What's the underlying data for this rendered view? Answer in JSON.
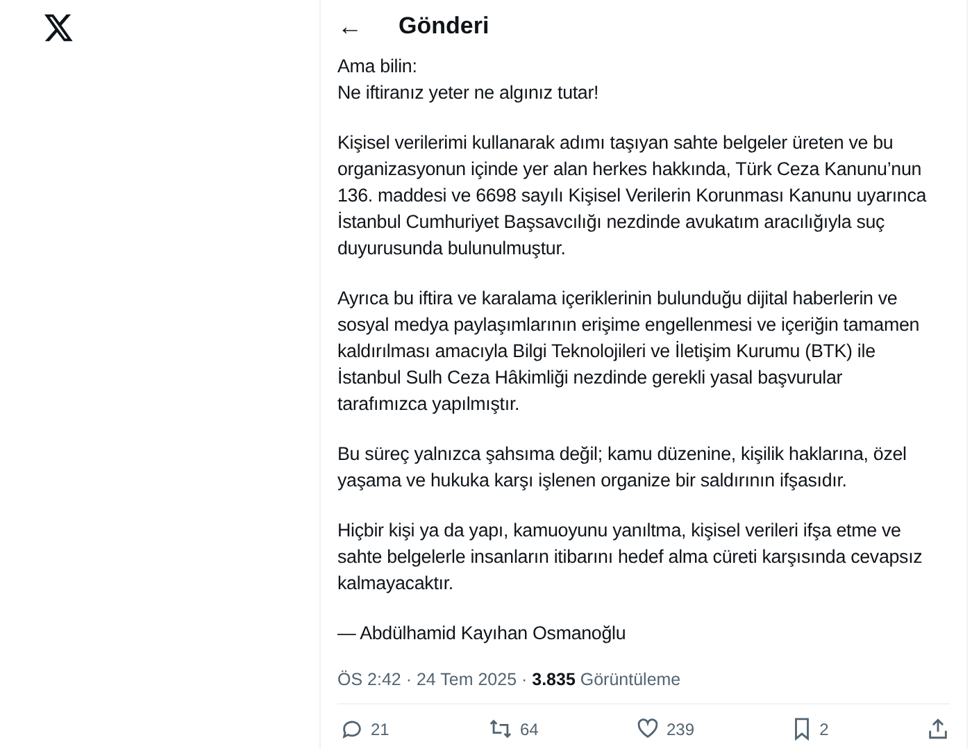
{
  "header": {
    "back": "←",
    "title": "Gönderi"
  },
  "paragraphs": [
    [
      "Ama bilin:",
      "Ne iftiranız yeter ne algınız tutar!"
    ],
    [
      "Kişisel verilerimi kullanarak adımı taşıyan sahte belgeler üreten ve bu",
      "organizasyonun içinde yer alan herkes hakkında, Türk Ceza Kanunu’nun",
      "136. maddesi ve 6698 sayılı Kişisel Verilerin Korunması Kanunu uyarınca",
      "İstanbul Cumhuriyet Başsavcılığı nezdinde avukatım aracılığıyla suç",
      "duyurusunda bulunulmuştur."
    ],
    [
      "Ayrıca bu iftira ve karalama içeriklerinin bulunduğu dijital haberlerin ve",
      "sosyal medya paylaşımlarının erişime engellenmesi ve içeriğin tamamen",
      "kaldırılması amacıyla Bilgi Teknolojileri ve İletişim Kurumu (BTK) ile",
      "İstanbul Sulh Ceza Hâkimliği nezdinde gerekli yasal başvurular",
      "tarafımızca yapılmıştır."
    ],
    [
      "Bu süreç yalnızca şahsıma değil; kamu düzenine, kişilik haklarına, özel",
      "yaşama ve hukuka karşı işlenen organize bir saldırının ifşasıdır."
    ],
    [
      "Hiçbir kişi ya da yapı, kamuoyunu yanıltma, kişisel verileri ifşa etme ve",
      "sahte belgelerle insanların itibarını hedef alma cüreti karşısında cevapsız",
      "kalmayacaktır."
    ],
    [
      "— Abdülhamid Kayıhan Osmanoğlu"
    ]
  ],
  "meta": "ÖS 2:42 · 24 Tem 2025 · **3.835** Görüntüleme",
  "actions": [
    {
      "kind": "reply",
      "count": "21"
    },
    {
      "kind": "repost",
      "count": "64"
    },
    {
      "kind": "like",
      "count": "239"
    },
    {
      "kind": "bookmark",
      "count": "2"
    },
    {
      "kind": "share"
    }
  ]
}
